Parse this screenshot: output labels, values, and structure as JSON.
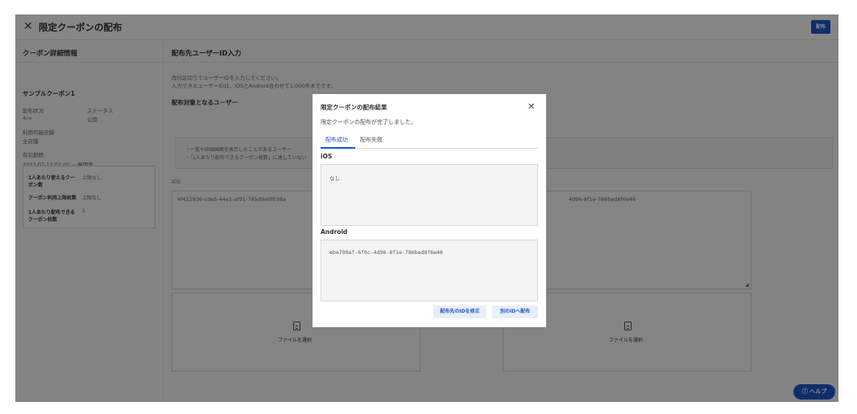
{
  "header": {
    "title": "限定クーポンの配布",
    "distribute_label": "配布"
  },
  "left": {
    "section_title": "クーポン詳細情報",
    "coupon_name": "サンプルクーポン1",
    "dist_status_label": "配布状況",
    "dist_status_value": "4/∞",
    "status_label": "ステータス",
    "status_value": "公開",
    "stores_label": "利用可能店舗",
    "stores_value": "全店舗",
    "period_label": "有効期間",
    "period_value": "2023-07-12 07:00 ~ 無期限",
    "limits": [
      {
        "label_line1": "1人あたり使えるクー",
        "label_line2": "ポン数",
        "value": "上限なし"
      },
      {
        "label_line1": "クーポン利用上限枚数",
        "label_line2": "",
        "value": "上限なし"
      },
      {
        "label_line1": "1人あたり配布できる",
        "label_line2": "クーポン枚数",
        "value": "1"
      }
    ]
  },
  "right": {
    "section_title": "配布先ユーザーID入力",
    "instr1": "改行区切りでユーザーIDを入力してください。",
    "instr2": "入力できるユーザーIDは、iOSとAndroid合わせて1,000件までです。",
    "target_title": "配布対象となるユーザー",
    "bullet1": "・一覧や詳細画面を表示したことがあるユーザー",
    "bullet2": "・「1人あたり配布できるクーポン枚数」に達していない",
    "ios_label": "iOS",
    "ios_value": "4f422936-cde5-44e1-af91-785d9e0f038a",
    "android_value": "4d96-8f1e-786bed8f6e46",
    "file_select": "ファイルを選択",
    "file_select_partial": "ファイルを選択"
  },
  "help": {
    "label": "ヘルプ",
    "icon": "question-circle-icon"
  },
  "modal": {
    "title": "限定クーポンの配布結果",
    "message": "限定クーポンの配布が完了しました。",
    "tabs": [
      {
        "label": "配布成功"
      },
      {
        "label": "配布失敗"
      }
    ],
    "ios_label": "iOS",
    "ios_text": "なし",
    "android_label": "Android",
    "android_text": "ebe799af-6f0c-4d96-8f1e-786bed8f6e46",
    "btn_edit": "配布先のIDを修正",
    "btn_other": "別のIDへ配布"
  },
  "colors": {
    "primary": "#1f56c7",
    "overlay": "rgba(0,0,0,0.46)"
  }
}
